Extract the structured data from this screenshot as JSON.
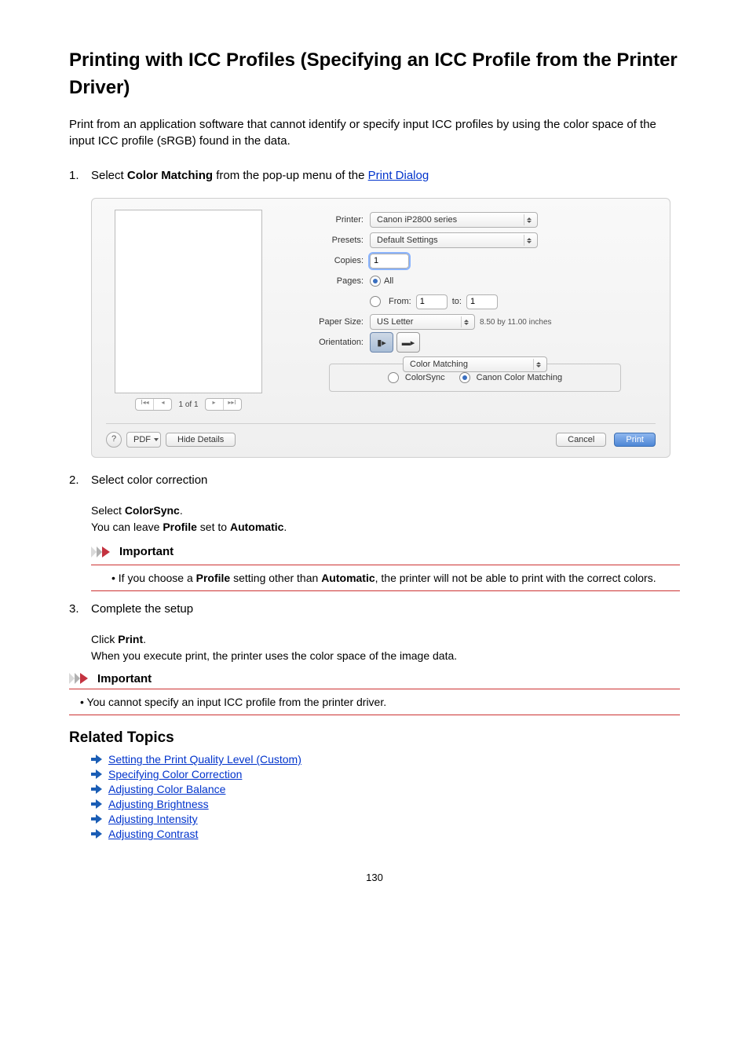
{
  "page": {
    "title": "Printing with ICC Profiles (Specifying an ICC Profile from the Printer Driver)",
    "intro": "Print from an application software that cannot identify or specify input ICC profiles by using the color space of the input ICC profile (sRGB) found in the data.",
    "number": "130"
  },
  "steps": {
    "s1": {
      "num": "1.",
      "prefix": "Select ",
      "bold": "Color Matching",
      "mid": " from the pop-up menu of the ",
      "link": "Print Dialog"
    },
    "s2": {
      "num": "2.",
      "title": "Select color correction",
      "sub_prefix": "Select ",
      "sub_bold": "ColorSync",
      "sub_suffix": ".",
      "sub_line2_a": "You can leave ",
      "sub_line2_b": "Profile",
      "sub_line2_c": " set to ",
      "sub_line2_d": "Automatic",
      "sub_line2_e": ".",
      "important_label": "Important",
      "important_a": "If you choose a ",
      "important_b": "Profile",
      "important_c": " setting other than ",
      "important_d": "Automatic",
      "important_e": ", the printer will not be able to print with the correct colors."
    },
    "s3": {
      "num": "3.",
      "title": "Complete the setup",
      "sub_a": "Click ",
      "sub_b": "Print",
      "sub_c": ".",
      "sub_line2": "When you execute print, the printer uses the color space of the image data."
    }
  },
  "bottom_important": {
    "label": "Important",
    "text": "You cannot specify an input ICC profile from the printer driver."
  },
  "related": {
    "heading": "Related Topics",
    "links": [
      "Setting the Print Quality Level (Custom)",
      "Specifying Color Correction",
      "Adjusting Color Balance",
      "Adjusting Brightness",
      "Adjusting Intensity",
      "Adjusting Contrast"
    ]
  },
  "dialog": {
    "labels": {
      "printer": "Printer:",
      "presets": "Presets:",
      "copies": "Copies:",
      "pages": "Pages:",
      "paper_size": "Paper Size:",
      "orientation": "Orientation:",
      "all": "All",
      "from": "From:",
      "to": "to:"
    },
    "values": {
      "printer": "Canon iP2800 series",
      "presets": "Default Settings",
      "copies": "1",
      "from": "1",
      "to": "1",
      "paper_size": "US Letter",
      "paper_dim": "8.50 by 11.00 inches",
      "options_popup": "Color Matching",
      "colorsync": "ColorSync",
      "canon_match": "Canon Color Matching"
    },
    "pager": "1 of 1",
    "buttons": {
      "help": "?",
      "pdf": "PDF",
      "hide": "Hide Details",
      "cancel": "Cancel",
      "print": "Print"
    }
  }
}
